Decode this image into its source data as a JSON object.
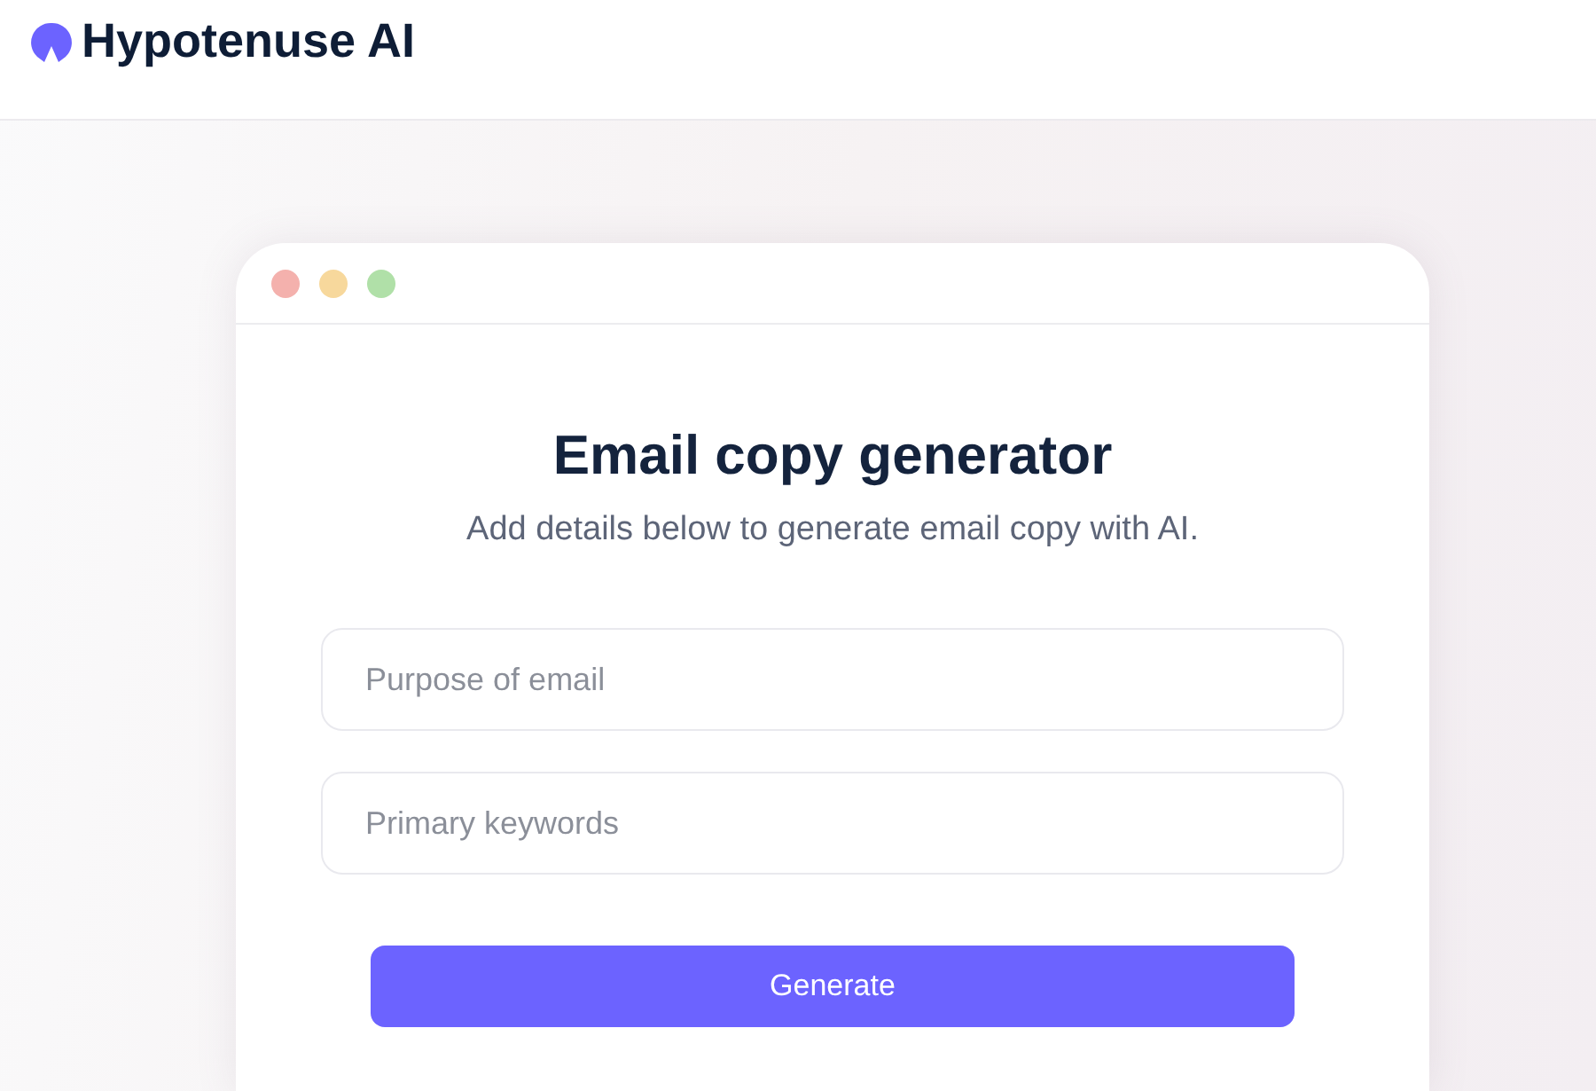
{
  "header": {
    "brand": "Hypotenuse AI"
  },
  "window": {
    "controls": [
      {
        "color": "#f4b1ad"
      },
      {
        "color": "#f7d89c"
      },
      {
        "color": "#b0e0a8"
      }
    ]
  },
  "form": {
    "title": "Email copy generator",
    "subtitle": "Add details below to generate email copy with AI.",
    "fields": [
      {
        "placeholder": "Purpose of email"
      },
      {
        "placeholder": "Primary keywords"
      }
    ],
    "button": "Generate"
  }
}
